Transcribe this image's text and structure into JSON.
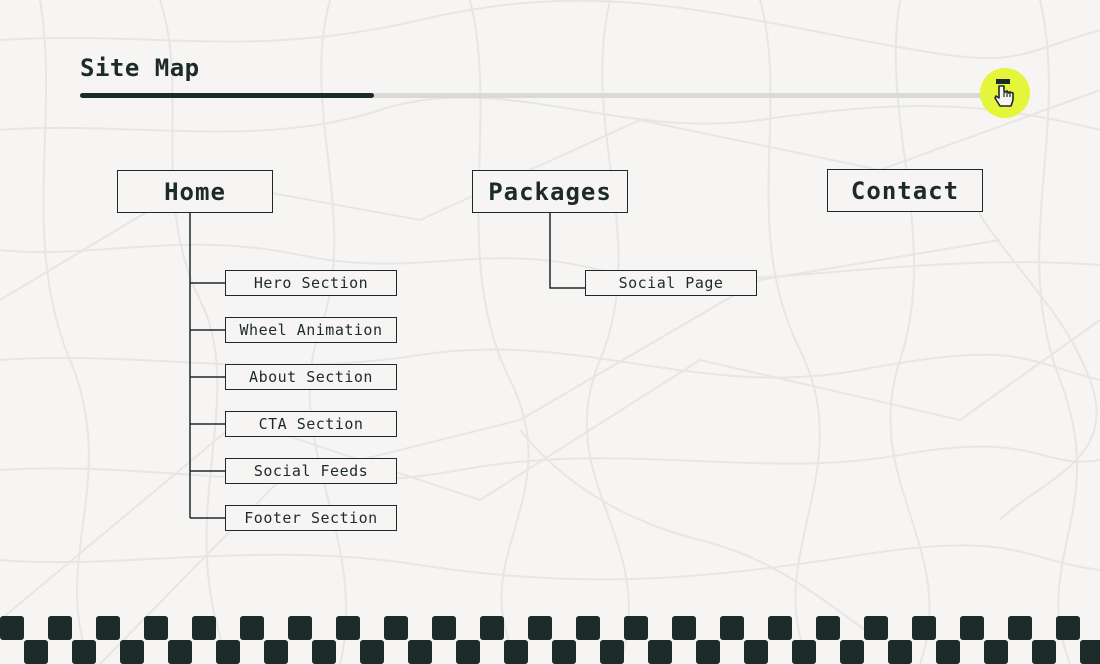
{
  "page": {
    "title": "Site Map",
    "progress_percent": 32
  },
  "colors": {
    "ink": "#1c2b2a",
    "background": "#f6f5f3",
    "accent": "#e4f53b",
    "track": "#d9d9d7",
    "map_lines": "#e7e6e4"
  },
  "cursor_icon": "pointing-hand-icon",
  "sitemap": {
    "top_nodes": [
      {
        "label": "Home"
      },
      {
        "label": "Packages"
      },
      {
        "label": "Contact"
      }
    ],
    "home_children": [
      {
        "label": "Hero Section"
      },
      {
        "label": "Wheel Animation"
      },
      {
        "label": "About Section"
      },
      {
        "label": "CTA Section"
      },
      {
        "label": "Social Feeds"
      },
      {
        "label": "Footer Section"
      }
    ],
    "packages_children": [
      {
        "label": "Social Page"
      }
    ]
  }
}
